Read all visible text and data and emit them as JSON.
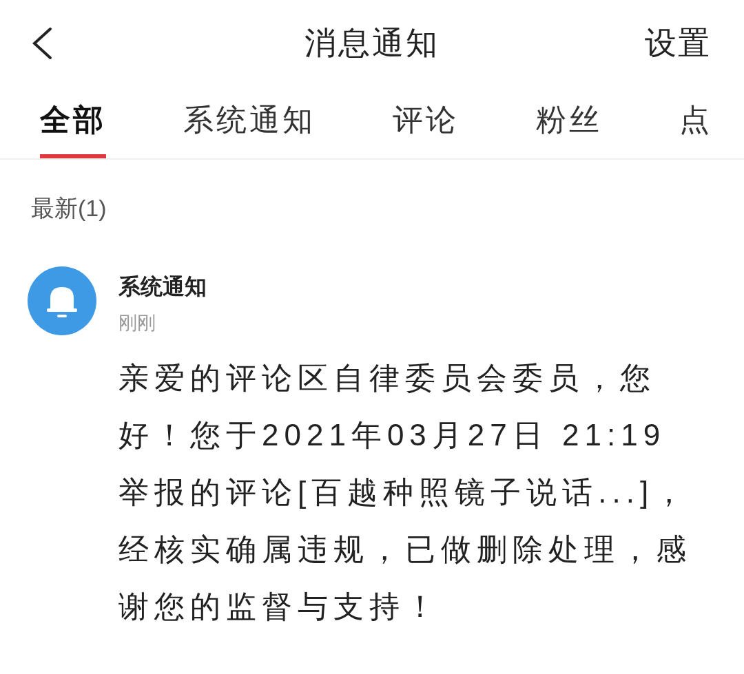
{
  "header": {
    "title": "消息通知",
    "action": "设置"
  },
  "tabs": [
    {
      "label": "全部",
      "selected": true
    },
    {
      "label": "系统通知",
      "selected": false
    },
    {
      "label": "评论",
      "selected": false
    },
    {
      "label": "粉丝",
      "selected": false
    },
    {
      "label": "点",
      "selected": false
    }
  ],
  "section": {
    "title": "最新(1)"
  },
  "notifications": [
    {
      "sender": "系统通知",
      "time": "刚刚",
      "message": "亲爱的评论区自律委员会委员，您好！您于2021年03月27日 21:19举报的评论[百越种照镜子说话...]，经核实确属违规，已做删除处理，感谢您的监督与支持！"
    }
  ]
}
